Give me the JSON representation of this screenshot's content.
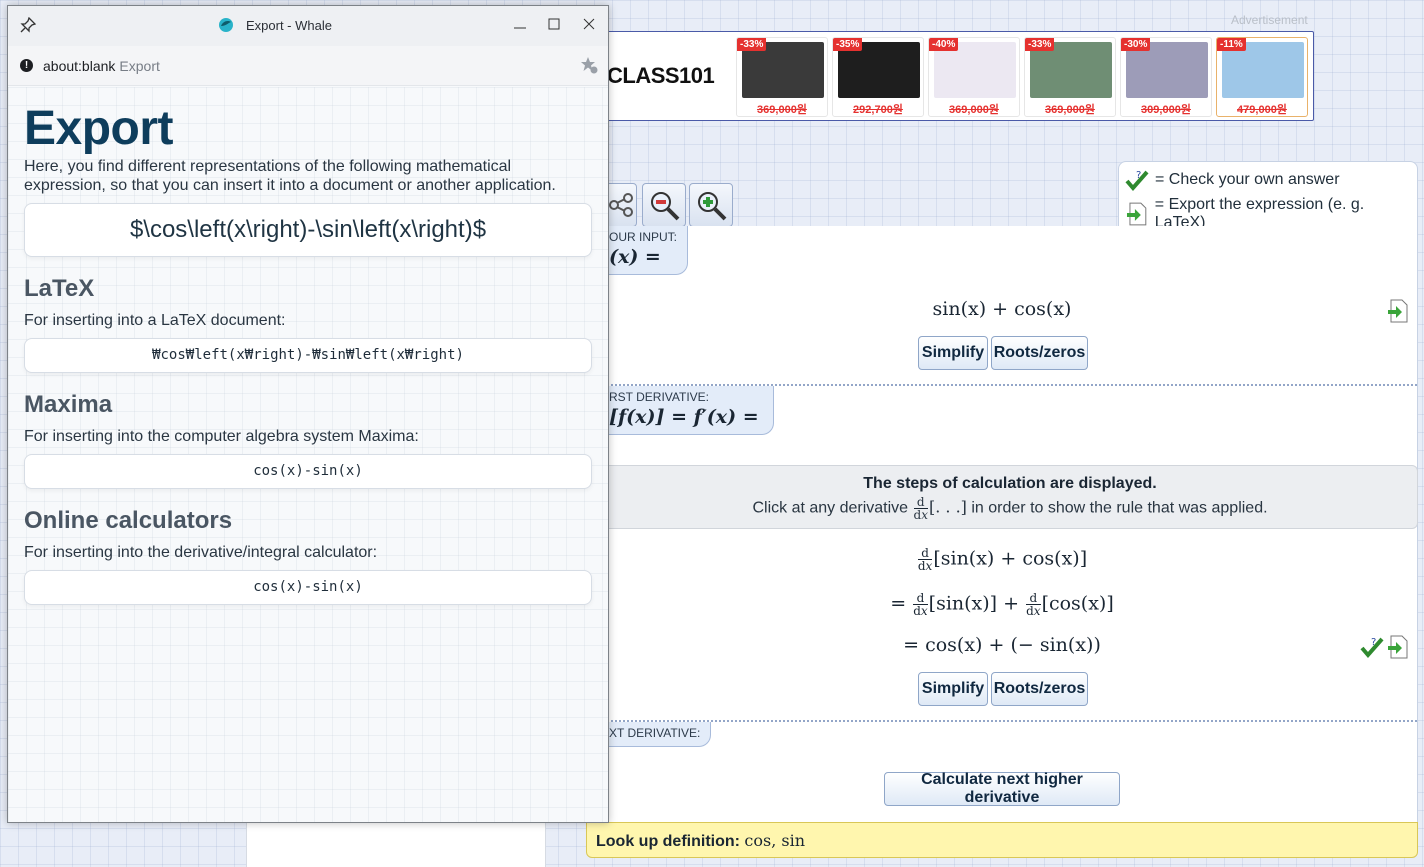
{
  "background": {
    "ad_label": "Advertisement",
    "ad": {
      "brand": "CLASS101",
      "items": [
        {
          "discount": "-33%",
          "price": "369,000원",
          "color": "#3a3a3a"
        },
        {
          "discount": "-35%",
          "price": "292,700원",
          "color": "#1e1e1e"
        },
        {
          "discount": "-40%",
          "price": "369,000원",
          "color": "#ece8f2"
        },
        {
          "discount": "-33%",
          "price": "369,000원",
          "color": "#6f8e74"
        },
        {
          "discount": "-30%",
          "price": "309,000원",
          "color": "#9d9cb8"
        },
        {
          "discount": "-11%",
          "price": "479,000원",
          "color": "#9ec7e8"
        }
      ]
    },
    "legend": {
      "check": "= Check your own answer",
      "export": "= Export the expression (e. g. LaTeX)"
    },
    "your_input": {
      "tag": "OUR INPUT:",
      "tag_math": "(x) =",
      "expression": "sin(x) + cos(x)",
      "simplify": "Simplify",
      "roots": "Roots/zeros"
    },
    "first_derivative": {
      "tag": "RST DERIVATIVE:",
      "tag_math": "[f(x)] = f′(x) =",
      "info_title": "The steps of calculation are displayed.",
      "info_text_pre": "Click at any derivative",
      "info_text_mid": "[. . .]",
      "info_text_post": "in order to show the rule that was applied.",
      "step1": "[sin(x) + cos(x)]",
      "step2a": "= ",
      "step2b": "[sin(x)] + ",
      "step2c": "[cos(x)]",
      "step3": "= cos(x) + (− sin(x))",
      "simplify": "Simplify",
      "roots": "Roots/zeros"
    },
    "next_derivative": {
      "tag": "XT DERIVATIVE:",
      "button": "Calculate next higher derivative"
    },
    "lookup": {
      "label": "Look up definition:",
      "links": "cos, sin"
    }
  },
  "popup": {
    "window_title": "Export - Whale",
    "url": "about:blank",
    "url_title": "Export",
    "heading": "Export",
    "intro": "Here, you find different representations of the following mathematical expression, so that you can insert it into a document or another application.",
    "expression": "$\\cos\\left(x\\right)-\\sin\\left(x\\right)$",
    "sections": [
      {
        "title": "LaTeX",
        "desc": "For inserting into a LaTeX document:",
        "code": "₩cos₩left(x₩right)-₩sin₩left(x₩right)"
      },
      {
        "title": "Maxima",
        "desc": "For inserting into the computer algebra system Maxima:",
        "code": "cos(x)-sin(x)"
      },
      {
        "title": "Online calculators",
        "desc": "For inserting into the derivative/integral calculator:",
        "code": "cos(x)-sin(x)"
      }
    ]
  }
}
